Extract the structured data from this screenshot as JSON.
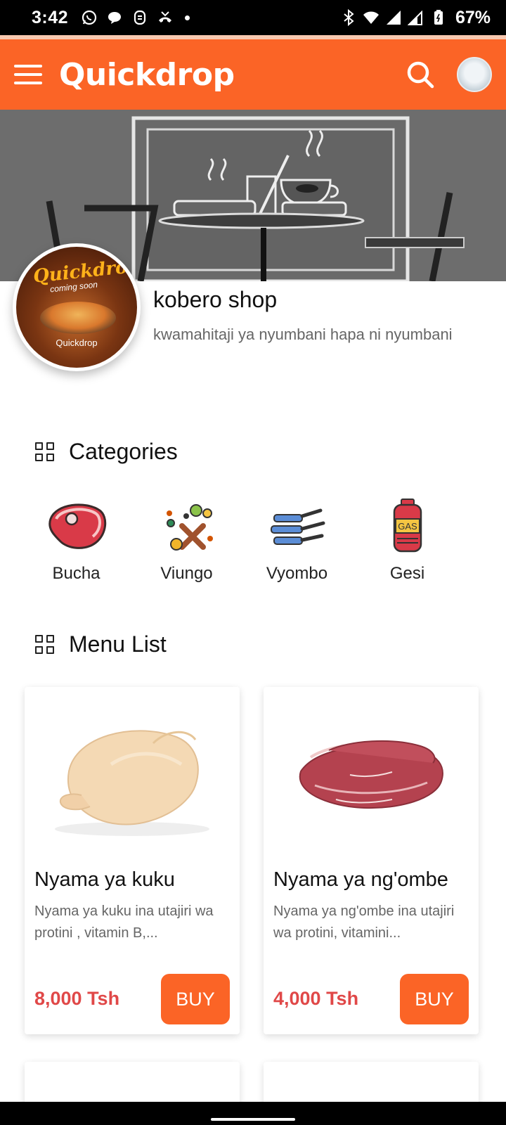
{
  "status_bar": {
    "time": "3:42",
    "battery": "67%"
  },
  "app_bar": {
    "brand": "Quickdrop",
    "brand_color": "#fb6426"
  },
  "shop": {
    "name": "kobero shop",
    "description": "kwamahitaji ya nyumbani hapa ni nyumbani",
    "logo": {
      "title": "Quickdrop",
      "subtitle": "coming soon",
      "brand": "Quickdrop"
    }
  },
  "categories": {
    "title": "Categories",
    "items": [
      {
        "label": "Bucha",
        "icon": "meat-icon"
      },
      {
        "label": "Viungo",
        "icon": "spices-icon"
      },
      {
        "label": "Vyombo",
        "icon": "pans-icon"
      },
      {
        "label": "Gesi",
        "icon": "gas-cylinder-icon"
      }
    ],
    "gas_label": "GAS"
  },
  "menu": {
    "title": "Menu List",
    "items": [
      {
        "title": "Nyama ya kuku",
        "description": "Nyama ya kuku ina utajiri wa protini , vitamin B,...",
        "price": "8,000 Tsh",
        "buy_label": "BUY",
        "image": "chicken-image"
      },
      {
        "title": "Nyama ya ng'ombe",
        "description": "Nyama ya ng'ombe ina utajiri wa protini, vitamini...",
        "price": "4,000 Tsh",
        "buy_label": "BUY",
        "image": "beef-image"
      }
    ]
  },
  "colors": {
    "accent": "#fb6426",
    "price": "#e04848"
  }
}
